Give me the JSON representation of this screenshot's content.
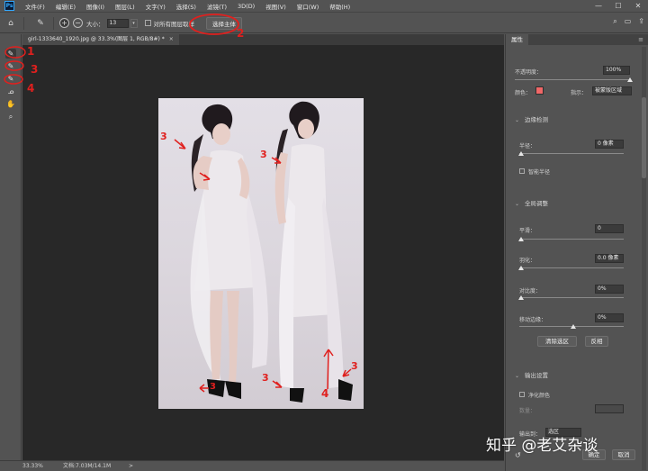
{
  "menubar": {
    "logo": "Ps",
    "items": [
      "文件(F)",
      "编辑(E)",
      "图像(I)",
      "图层(L)",
      "文字(Y)",
      "选择(S)",
      "滤镜(T)",
      "3D(D)",
      "视图(V)",
      "窗口(W)",
      "帮助(H)"
    ],
    "window_controls": [
      "—",
      "☐",
      "✕"
    ]
  },
  "options": {
    "size_label": "大小：",
    "size_value": "13",
    "sample_all_layers": "对所有图层取样",
    "select_subject": "选择主体"
  },
  "document": {
    "tab_title": "girl-1333640_1920.jpg @ 33.3%(图层 1, RGB/8#) *",
    "close": "×"
  },
  "status": {
    "zoom": "33.33%",
    "doc_info": "文档:7.03M/14.1M",
    "arrow": ">"
  },
  "panel": {
    "tab": "属性",
    "opacity_label": "不透明度：",
    "opacity_value": "100%",
    "color_label": "颜色：",
    "color_value": "#f06767",
    "indicate_label": "指示：",
    "indicate_value": "被蒙版区域",
    "edge_detection": "边缘检测",
    "radius_label": "半径：",
    "radius_value": "0 像素",
    "smart_radius": "智能半径",
    "global_refine": "全局调整",
    "smooth_label": "平滑：",
    "smooth_value": "0",
    "feather_label": "羽化：",
    "feather_value": "0.0 像素",
    "contrast_label": "对比度：",
    "contrast_value": "0%",
    "shift_edge_label": "移动边缘：",
    "shift_edge_value": "0%",
    "clear_selection": "清除选区",
    "invert": "反相",
    "output_settings": "输出设置",
    "decontaminate": "净化颜色",
    "amount_label": "数量：",
    "output_to_label": "输出到：",
    "output_to_value": "选区",
    "ok": "确定",
    "cancel": "取消"
  },
  "annotations": {
    "n1": "1",
    "n2": "2",
    "n3a": "3",
    "n4": "4",
    "photo_3a": "3",
    "photo_3b": "3",
    "photo_3c": "3",
    "photo_3d": "3",
    "photo_3e": "3",
    "photo_4": "4"
  },
  "watermark": "知乎 @老艾杂谈",
  "colors": {
    "annotation": "#e0201e",
    "chrome": "#535353",
    "canvas": "#282828",
    "accent": "#31a8ff"
  }
}
